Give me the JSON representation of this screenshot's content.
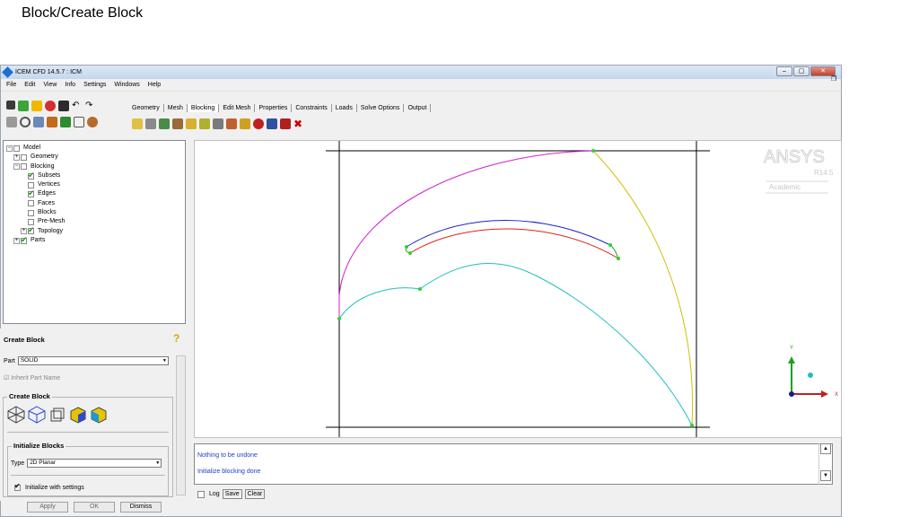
{
  "slide": {
    "title": "Block/Create Block"
  },
  "window": {
    "title": "ICEM CFD 14.5.7 : ICM",
    "controls": [
      "minimize",
      "maximize",
      "close"
    ]
  },
  "menu": {
    "items": [
      "File",
      "Edit",
      "View",
      "Info",
      "Settings",
      "Windows",
      "Help"
    ]
  },
  "tabs": {
    "items": [
      "Geometry",
      "Mesh",
      "Blocking",
      "Edit Mesh",
      "Properties",
      "Constraints",
      "Loads",
      "Solve Options",
      "Output"
    ],
    "active": "Blocking"
  },
  "tree": {
    "items": [
      {
        "label": "Model",
        "level": 0,
        "checked": false
      },
      {
        "label": "Geometry",
        "level": 1,
        "checked": false
      },
      {
        "label": "Blocking",
        "level": 1,
        "checked": false
      },
      {
        "label": "Subsets",
        "level": 2,
        "checked": true
      },
      {
        "label": "Vertices",
        "level": 2,
        "checked": false
      },
      {
        "label": "Edges",
        "level": 2,
        "checked": true
      },
      {
        "label": "Faces",
        "level": 2,
        "checked": false
      },
      {
        "label": "Blocks",
        "level": 2,
        "checked": false
      },
      {
        "label": "Pre-Mesh",
        "level": 2,
        "checked": false
      },
      {
        "label": "Topology",
        "level": 2,
        "checked": true
      },
      {
        "label": "Parts",
        "level": 1,
        "checked": true
      }
    ]
  },
  "panel": {
    "title": "Create Block",
    "part_label": "Part",
    "part_value": "SOLID",
    "inherit_label": "Inherit Part Name",
    "create_block_group": "Create Block",
    "initialize_group": "Initialize Blocks",
    "type_label": "Type",
    "type_value": "2D Planar",
    "init_settings_label": "Initialize with settings",
    "buttons": {
      "apply": "Apply",
      "ok": "OK",
      "dismiss": "Dismiss"
    }
  },
  "viewport": {
    "logo": "ANSYS",
    "logo_version": "R14.5",
    "logo_sub": "Academic",
    "axis_x": "X",
    "axis_y": "Y"
  },
  "console": {
    "lines": [
      "Nothing to be undone",
      "Initialize blocking done"
    ],
    "log_label": "Log",
    "save_label": "Save",
    "clear_label": "Clear"
  }
}
